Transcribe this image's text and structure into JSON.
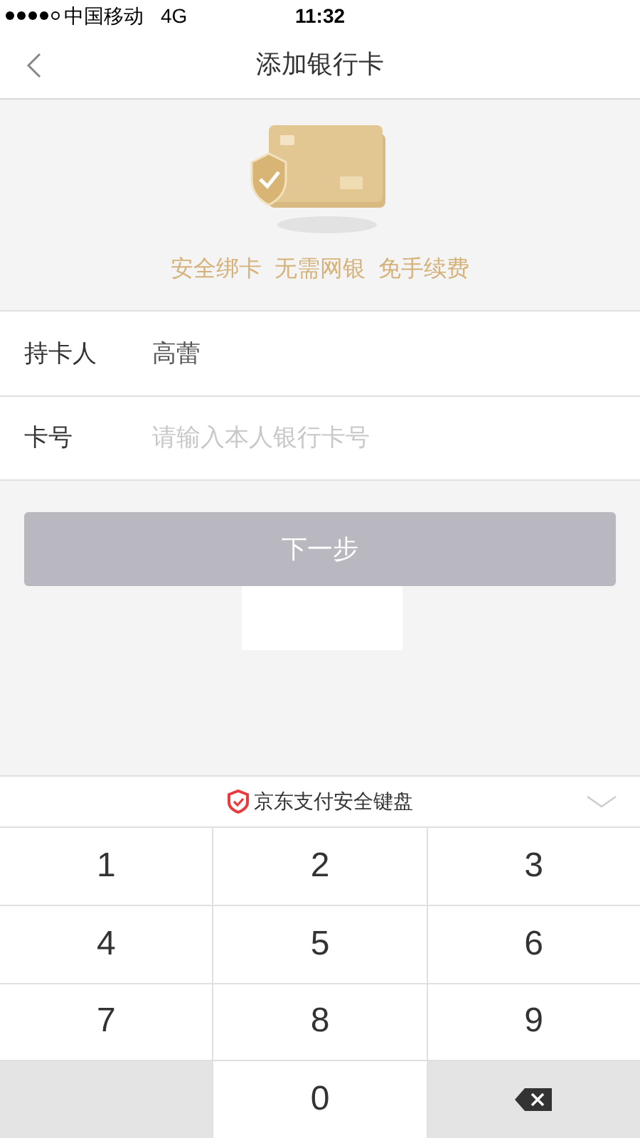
{
  "status_bar": {
    "carrier": "中国移动",
    "network": "4G",
    "time": "11:32"
  },
  "nav": {
    "title": "添加银行卡"
  },
  "tagline": "安全绑卡  无需网银  免手续费",
  "form": [
    {
      "label": "持卡人",
      "value": "高蕾"
    },
    {
      "label": "卡号",
      "placeholder": "请输入本人银行卡号"
    }
  ],
  "next_button": {
    "label": "下一步",
    "disabled": true
  },
  "keyboard": {
    "title": "京东支付安全键盘",
    "keys": [
      {
        "kind": "digit",
        "label": "1"
      },
      {
        "kind": "digit",
        "label": "2"
      },
      {
        "kind": "digit",
        "label": "3"
      },
      {
        "kind": "digit",
        "label": "4"
      },
      {
        "kind": "digit",
        "label": "5"
      },
      {
        "kind": "digit",
        "label": "6"
      },
      {
        "kind": "digit",
        "label": "7"
      },
      {
        "kind": "digit",
        "label": "8"
      },
      {
        "kind": "digit",
        "label": "9"
      },
      {
        "kind": "blank"
      },
      {
        "kind": "digit",
        "label": "0"
      },
      {
        "kind": "delete"
      }
    ]
  }
}
